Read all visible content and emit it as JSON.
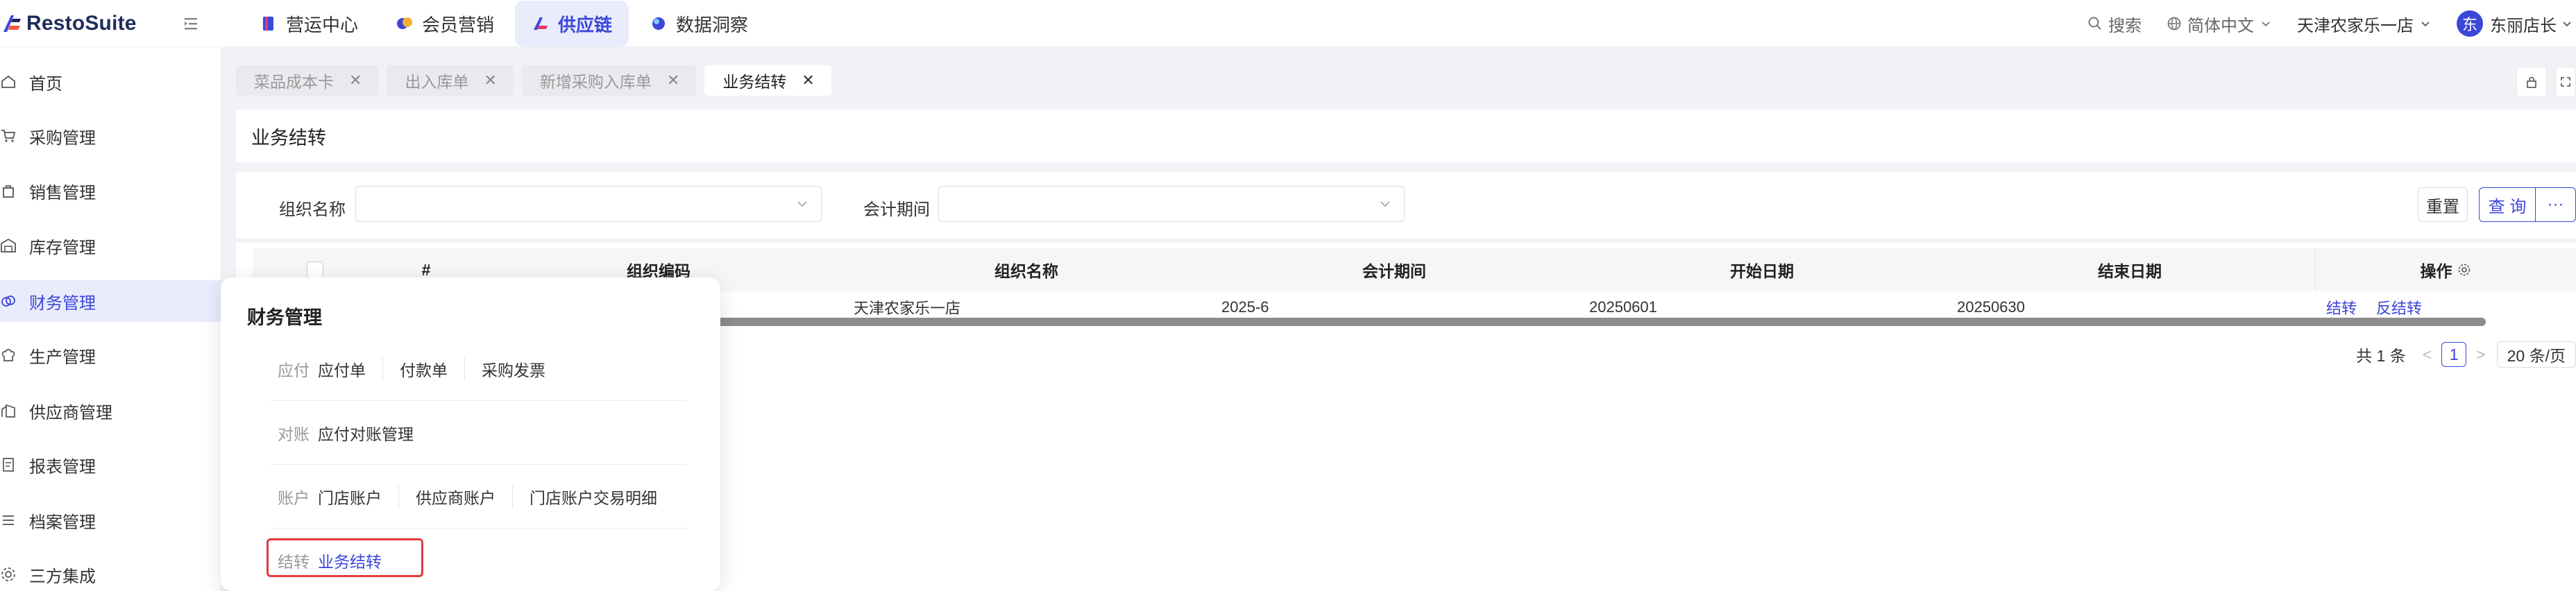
{
  "app": {
    "logo_text": "RestoSuite"
  },
  "topnav": [
    {
      "label": "营运中心",
      "icon": "book-icon",
      "color": "#3b47d9"
    },
    {
      "label": "会员营销",
      "icon": "members-icon",
      "color": "#f2b134"
    },
    {
      "label": "供应链",
      "icon": "supply-chain-icon",
      "color": "#3b47d9",
      "active": true
    },
    {
      "label": "数据洞察",
      "icon": "insight-icon",
      "color": "#3b47d9"
    }
  ],
  "header_right": {
    "search": "搜索",
    "language": "简体中文",
    "store": "天津农家乐一店",
    "avatar_char": "东",
    "user": "东丽店长"
  },
  "sidebar": [
    {
      "label": "首页",
      "icon": "home-icon"
    },
    {
      "label": "采购管理",
      "icon": "cart-icon"
    },
    {
      "label": "销售管理",
      "icon": "bag-icon"
    },
    {
      "label": "库存管理",
      "icon": "warehouse-icon"
    },
    {
      "label": "财务管理",
      "icon": "finance-icon",
      "active": true
    },
    {
      "label": "生产管理",
      "icon": "chef-hat-icon"
    },
    {
      "label": "供应商管理",
      "icon": "supplier-icon"
    },
    {
      "label": "报表管理",
      "icon": "report-icon"
    },
    {
      "label": "档案管理",
      "icon": "list-icon"
    },
    {
      "label": "三方集成",
      "icon": "integration-icon"
    }
  ],
  "tabs": [
    {
      "label": "菜品成本卡"
    },
    {
      "label": "出入库单"
    },
    {
      "label": "新增采购入库单"
    },
    {
      "label": "业务结转",
      "active": true
    }
  ],
  "page": {
    "title": "业务结转"
  },
  "filters": {
    "org_label": "组织名称",
    "org_value": "",
    "period_label": "会计期间",
    "period_value": "",
    "reset": "重置",
    "query": "查 询",
    "more": "···"
  },
  "table": {
    "columns": [
      "#",
      "组织编码",
      "组织名称",
      "会计期间",
      "开始日期",
      "结束日期",
      "操作"
    ],
    "rows": [
      {
        "org_name": "天津农家乐一店",
        "period": "2025-6",
        "start": "20250601",
        "end": "20250630",
        "actions": [
          "结转",
          "反结转"
        ]
      }
    ]
  },
  "pagination": {
    "total": "共 1 条",
    "prev": "<",
    "current": "1",
    "next": ">",
    "page_size": "20 条/页"
  },
  "flyout": {
    "title": "财务管理",
    "groups": [
      {
        "category": "应付",
        "links": [
          "应付单",
          "付款单",
          "采购发票"
        ]
      },
      {
        "category": "对账",
        "links": [
          "应付对账管理"
        ]
      },
      {
        "category": "账户",
        "links": [
          "门店账户",
          "供应商账户",
          "门店账户交易明细"
        ]
      },
      {
        "category": "结转",
        "links": [
          "业务结转"
        ],
        "highlighted": true
      }
    ]
  },
  "colors": {
    "accent": "#3b47d9",
    "highlight_box": "#e33a3a"
  }
}
